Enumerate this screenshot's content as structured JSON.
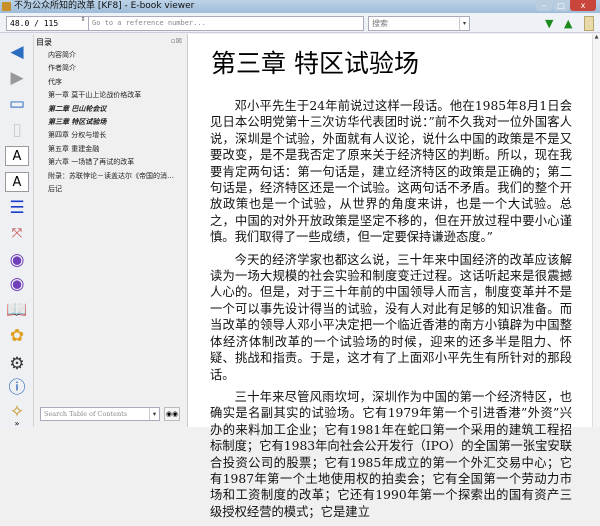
{
  "window": {
    "title": "不为公众所知的改革 [KF8] - E-book viewer",
    "minimize": "–",
    "maximize": "□",
    "close": "x"
  },
  "toolbar": {
    "position": "48.0 / 115",
    "reference_placeholder": "Go to a reference number...",
    "search_value": "搜索"
  },
  "toc": {
    "title": "目录",
    "items": [
      {
        "label": "内容简介",
        "current": false
      },
      {
        "label": "作者简介",
        "current": false
      },
      {
        "label": "代序",
        "current": false
      },
      {
        "label": "第一章 莫干山上论战价格改革",
        "current": false
      },
      {
        "label": "第二章 巴山轮会议",
        "current": true
      },
      {
        "label": "第三章 特区试验场",
        "current": true
      },
      {
        "label": "第四章 分权与增长",
        "current": false
      },
      {
        "label": "第五章 重建金融",
        "current": false
      },
      {
        "label": "第六章 一场错了再试的改革",
        "current": false
      },
      {
        "label": "附录：苏联悖论－读盖达尔《帝国的消…",
        "current": false
      },
      {
        "label": "后记",
        "current": false
      }
    ],
    "search_placeholder": "Search Table of Contents"
  },
  "content": {
    "heading": "第三章 特区试验场",
    "paragraphs": [
      "邓小平先生于24年前说过这样一段话。他在1985年8月1日会见日本公明党第十三次访华代表团时说：”前不久我对一位外国客人说，深圳是个试验，外面就有人议论，说什么中国的政策是不是又要改变，是不是我否定了原来关于经济特区的判断。所以，现在我要肯定两句话：第一句话是，建立经济特区的政策是正确的；第二句话是，经济特区还是一个试验。这两句话不矛盾。我们的整个开放政策也是一个试验，从世界的角度来讲，也是一个大试验。总之，中国的对外开放政策是坚定不移的，但在开放过程中要小心谨慎。我们取得了一些成绩，但一定要保持谦逊态度。”",
      "今天的经济学家也都这么说，三十年来中国经济的改革应该解读为一场大规模的社会实验和制度变迁过程。这话听起来是很震撼人心的。但是，对于三十年前的中国领导人而言，制度变革并不是一个可以事先设计得当的试验，没有人对此有足够的知识准备。而当改革的领导人邓小平决定把一个临近香港的南方小镇辟为中国整体经济体制改革的一个试验场的时候，迎来的还多半是阻力、怀疑、挑战和指责。于是，这才有了上面邓小平先生有所针对的那段话。",
      "三十年来尽管风雨坎坷，深圳作为中国的第一个经济特区，也确实是名副其实的试验场。它有1979年第一个引进香港”外资”兴办的来料加工企业；它有1981年在蛇口第一个采用的建筑工程招标制度；它有1983年向社会公开发行（IPO）的全国第一张宝安联合投资公司的股票；它有1985年成立的第一个外汇交易中心；它有1987年第一个土地使用权的拍卖会；它有全国第一个劳动力市场和工资制度的改革；它还有1990年第一个探索出的国有资产三级授权经营的模式；它是建立"
    ]
  },
  "icons": {
    "spin": "⇕",
    "down": "▼",
    "up": "▲",
    "dd": "▾",
    "binoculars": "⚲",
    "more": "»"
  }
}
